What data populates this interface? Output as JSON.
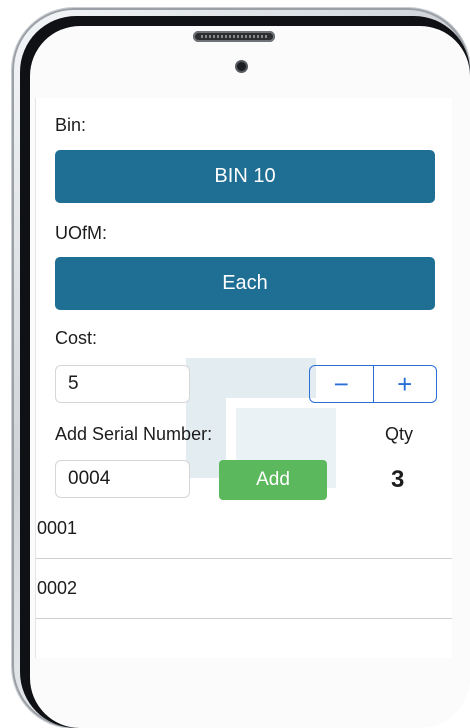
{
  "form": {
    "bin_label": "Bin:",
    "bin_value": "BIN 10",
    "uofm_label": "UOfM:",
    "uofm_value": "Each",
    "cost_label": "Cost:",
    "cost_value": "5",
    "stepper_minus": "−",
    "stepper_plus": "+",
    "serial_label": "Add Serial Number:",
    "qty_label": "Qty",
    "serial_input_value": "0004",
    "add_button": "Add",
    "qty_value": "3"
  },
  "serials": [
    "0001",
    "0002"
  ],
  "colors": {
    "picker_bg": "#1f6e93",
    "add_button_bg": "#5cb85c",
    "stepper_accent": "#2a6fd6"
  }
}
